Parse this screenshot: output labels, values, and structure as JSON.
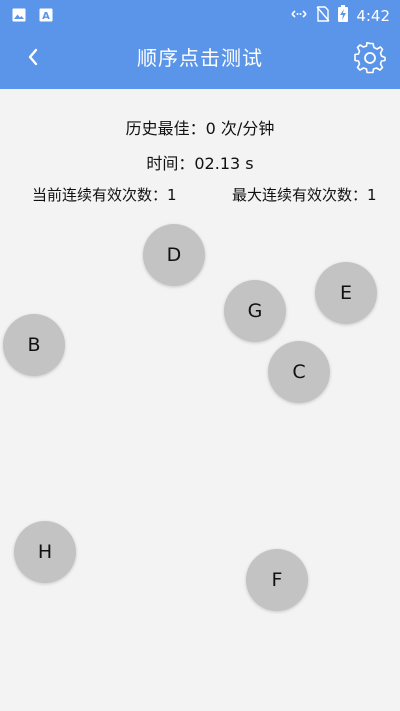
{
  "status_bar": {
    "time": "4:42",
    "left_icons": [
      "image-icon",
      "font-icon"
    ],
    "right_icons": [
      "data-sync-icon",
      "no-sim-icon",
      "battery-charging-icon"
    ]
  },
  "toolbar": {
    "title": "顺序点击测试",
    "back_icon": "chevron-left-icon",
    "settings_icon": "gear-icon"
  },
  "stats": {
    "best": "历史最佳：0 次/分钟",
    "time": "时间：02.13 s",
    "current_streak": "当前连续有效次数：1",
    "max_streak": "最大连续有效次数：1"
  },
  "targets": [
    {
      "label": "D"
    },
    {
      "label": "E"
    },
    {
      "label": "G"
    },
    {
      "label": "B"
    },
    {
      "label": "C"
    },
    {
      "label": "H"
    },
    {
      "label": "F"
    }
  ],
  "colors": {
    "header": "#5b95e9",
    "background": "#f3f3f3",
    "target": "#c3c3c3"
  }
}
